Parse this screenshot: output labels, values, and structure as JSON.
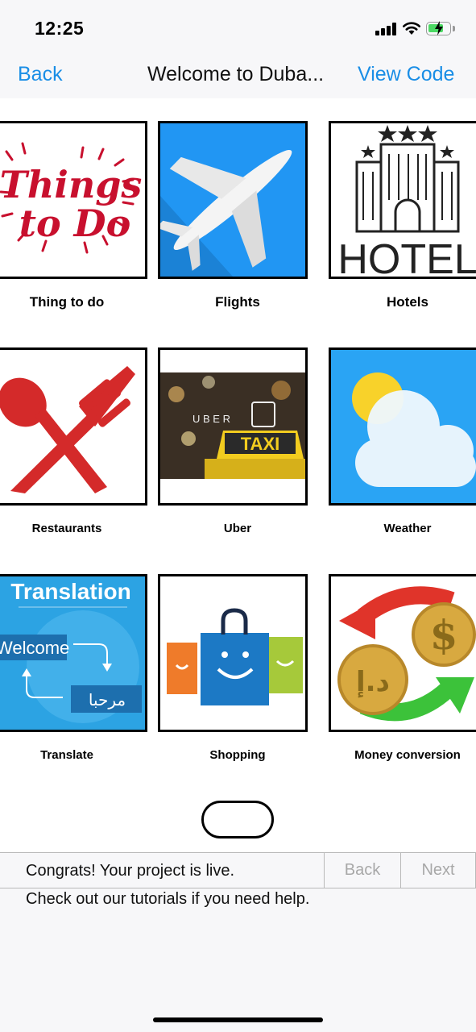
{
  "status_bar": {
    "time": "12:25",
    "icons": [
      "signal-icon",
      "wifi-icon",
      "battery-charging-icon"
    ]
  },
  "nav": {
    "back_label": "Back",
    "title": "Welcome to Duba...",
    "view_code_label": "View Code"
  },
  "tiles": [
    {
      "label": "Thing to do",
      "icon": "things-to-do-image",
      "image_text": [
        "Things",
        "to Do"
      ]
    },
    {
      "label": "Flights",
      "icon": "airplane-image"
    },
    {
      "label": "Hotels",
      "icon": "hotel-image",
      "image_text": "HOTEL"
    },
    {
      "label": "Restaurants",
      "icon": "fork-spoon-image"
    },
    {
      "label": "Uber",
      "icon": "uber-taxi-image",
      "image_text": [
        "U B E R",
        "TAXI"
      ]
    },
    {
      "label": "Weather",
      "icon": "weather-image"
    },
    {
      "label": "Translate",
      "icon": "translation-image",
      "image_text": [
        "Translation",
        "Welcome",
        "مرحبا"
      ]
    },
    {
      "label": "Shopping",
      "icon": "shopping-bags-image"
    },
    {
      "label": "Money conversion",
      "icon": "money-conversion-image",
      "image_text": [
        "$",
        "د.إ"
      ]
    }
  ],
  "bottom_bar": {
    "message": "Congrats! Your project is live.",
    "back_label": "Back",
    "next_label": "Next",
    "help_text": "Check out our tutorials if you need help."
  },
  "colors": {
    "accent": "#1a8ee6",
    "disabled": "#a8a8a8"
  }
}
